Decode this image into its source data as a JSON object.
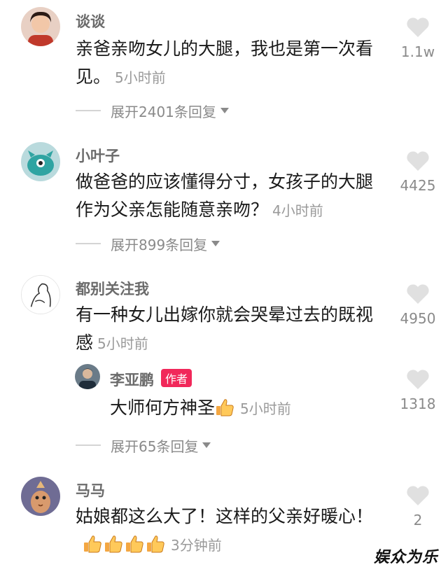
{
  "colors": {
    "heart": "#e0e0e0",
    "badge": "#f1285a",
    "text": "#1a1a1a",
    "meta": "#9a9a9a"
  },
  "comments": [
    {
      "username": "谈谈",
      "text": "亲爸亲吻女儿的大腿，我也是第一次看见。",
      "time": "5小时前",
      "likes": "1.1w",
      "expand_label": "展开2401条回复"
    },
    {
      "username": "小叶子",
      "text": "做爸爸的应该懂得分寸，女孩子的大腿作为父亲怎能随意亲吻？",
      "time": "4小时前",
      "likes": "4425",
      "expand_label": "展开899条回复"
    },
    {
      "username": "都别关注我",
      "text": "有一种女儿出嫁你就会哭晕过去的既视感",
      "time": "5小时前",
      "likes": "4950",
      "expand_label": "展开65条回复",
      "reply": {
        "username": "李亚鹏",
        "badge": "作者",
        "text": "大师何方神圣",
        "time": "5小时前",
        "likes": "1318"
      }
    },
    {
      "username": "马马",
      "text": "姑娘都这么大了！这样的父亲好暖心！",
      "time": "3分钟前",
      "likes": "2"
    }
  ],
  "watermark": "娱众为乐"
}
